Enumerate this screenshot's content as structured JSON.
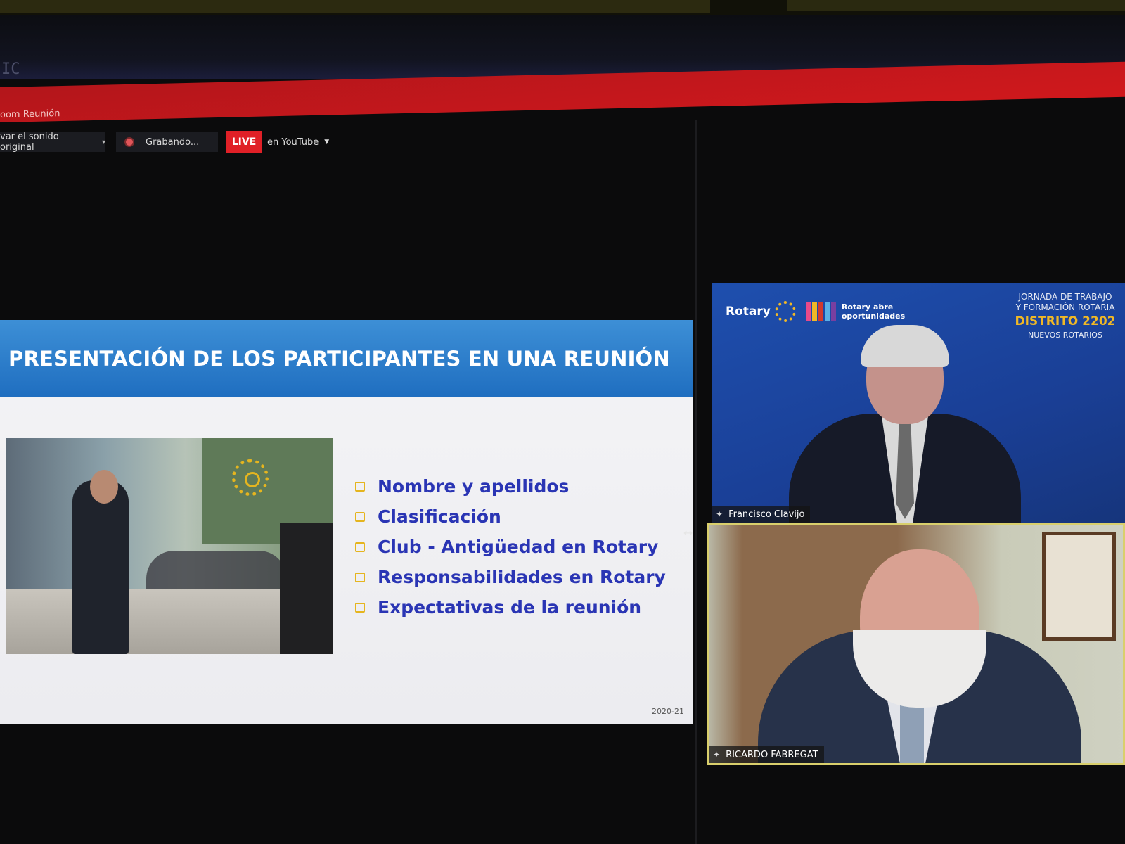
{
  "window": {
    "corner_text": "IC",
    "app_title": "oom Reunión"
  },
  "toolbar": {
    "audio_label": "var el sonido original",
    "recording_label": "Grabando...",
    "live_label": "LIVE",
    "stream_label": "en YouTube"
  },
  "slide": {
    "title": "PRESENTACIÓN DE LOS PARTICIPANTES EN UNA REUNIÓN",
    "bullets": [
      "Nombre y apellidos",
      "Clasificación",
      "Club - Antigüedad en Rotary",
      "Responsabilidades en Rotary",
      "Expectativas de la reunión"
    ],
    "year": "2020-21"
  },
  "video_tiles": [
    {
      "name": "Francisco Clavijo",
      "background": {
        "brand": "Rotary",
        "tagline": "Rotary abre oportunidades",
        "event_line1": "JORNADA DE TRABAJO",
        "event_line2": "Y FORMACIÓN ROTARIA",
        "district": "DISTRITO 2202",
        "audience": "NUEVOS ROTARIOS"
      }
    },
    {
      "name": "RICARDO FABREGAT",
      "active_speaker": true
    }
  ],
  "colors": {
    "zoom_red": "#d0181c",
    "live_red": "#e02027",
    "slide_header_blue": "#2a7ccc",
    "bullet_text": "#2a35b4",
    "rotary_gold": "#f0b826",
    "active_speaker_border": "#d9cf6c"
  },
  "icons": [
    "record-icon",
    "chevron-down-icon",
    "pin-icon",
    "rotary-wheel-icon",
    "resize-arrow-icon"
  ]
}
